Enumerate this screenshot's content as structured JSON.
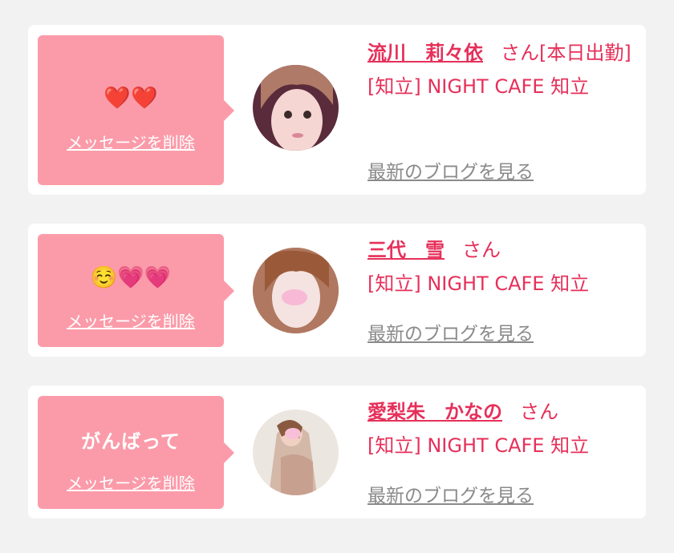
{
  "posts": [
    {
      "message": "❤️❤️",
      "delete_label": "メッセージを削除",
      "name": "流川　莉々依",
      "honorific": "さん",
      "status": "[本日出勤]",
      "shop": "[知立] NIGHT CAFE 知立",
      "blog_label": "最新のブログを見る",
      "avatar_colors": [
        "#5a2b3a",
        "#f5d6d2",
        "#b07a68"
      ]
    },
    {
      "message": "☺️💗💗",
      "delete_label": "メッセージを削除",
      "name": "三代　雪",
      "honorific": "さん",
      "status": "",
      "shop": "[知立] NIGHT CAFE 知立",
      "blog_label": "最新のブログを見る",
      "avatar_colors": [
        "#c9a89a",
        "#f4e3e0",
        "#9a5a3a"
      ]
    },
    {
      "message": "がんばって",
      "delete_label": "メッセージを削除",
      "name": "愛梨朱　かなの",
      "honorific": "さん",
      "status": "",
      "shop": "[知立] NIGHT CAFE 知立",
      "blog_label": "最新のブログを見る",
      "avatar_colors": [
        "#e9e2dc",
        "#d4b8a8",
        "#b48a70"
      ]
    }
  ],
  "colors": {
    "bubble": "#fb9ba9",
    "accent": "#e6305a",
    "link_gray": "#8a8a8a",
    "background": "#f2f2f2"
  }
}
